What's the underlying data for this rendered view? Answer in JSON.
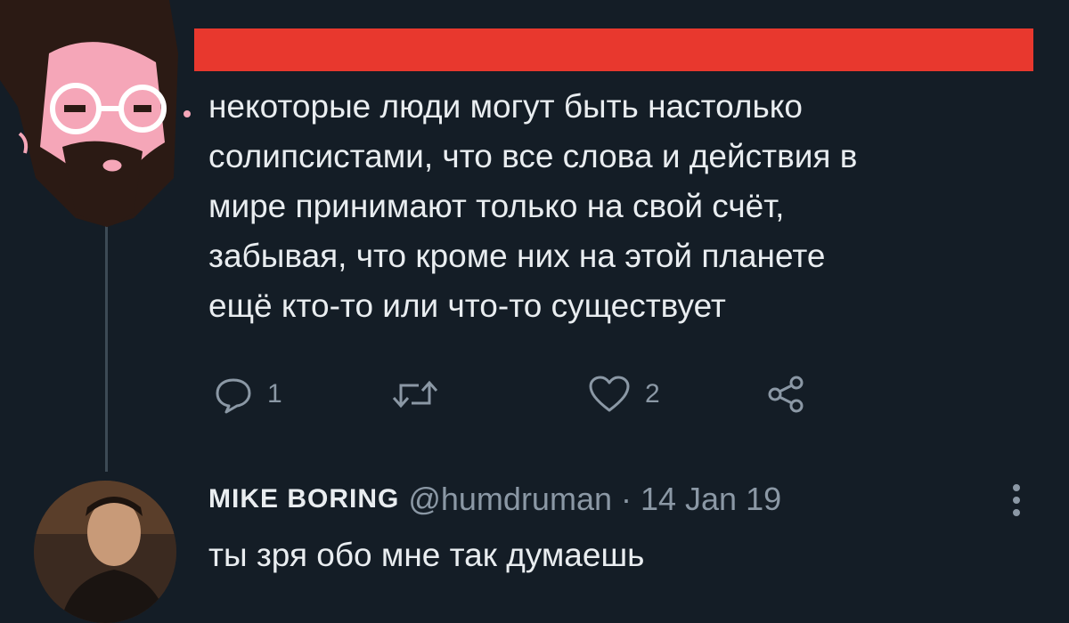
{
  "tweet": {
    "text": "некоторые люди могут быть настолько\nсолипсистами, что все слова и действия в\nмире принимают только на свой счёт,\nзабывая, что кроме них на этой планете\nещё кто-то или что-то существует",
    "reply_count": "1",
    "like_count": "2",
    "redaction_color": "#e8382e"
  },
  "icons": {
    "reply": "reply-icon",
    "retweet": "retweet-icon",
    "like": "heart-icon",
    "share": "share-icon",
    "more": "more-vertical-icon"
  },
  "reply": {
    "name": "MIKE BORING",
    "handle_date": "@humdruman · 14 Jan 19",
    "text": "ты зря обо мне так думаешь"
  },
  "colors": {
    "background": "#141d26",
    "text": "#e9edf0",
    "muted": "#8b98a5",
    "avatar_skin": "#f5a6b8",
    "avatar_hair": "#2b1a14"
  }
}
